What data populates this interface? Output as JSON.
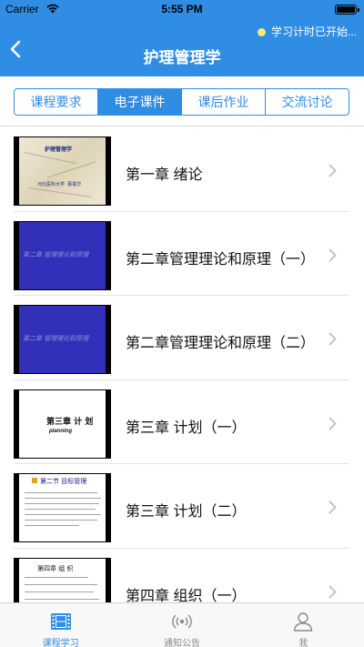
{
  "status_bar": {
    "carrier": "Carrier",
    "time": "5:55 PM"
  },
  "nav": {
    "title": "护理管理学",
    "timer_notice": "学习计时已开始..."
  },
  "tabs": [
    {
      "label": "课程要求",
      "active": false
    },
    {
      "label": "电子课件",
      "active": true
    },
    {
      "label": "课后作业",
      "active": false
    },
    {
      "label": "交流讨论",
      "active": false
    }
  ],
  "items": [
    {
      "title": "第一章 绪论",
      "thumb_lines": [
        "护理管理学",
        "河北医科大学",
        "蔡振华"
      ]
    },
    {
      "title": "第二章管理理论和原理（一）",
      "thumb_lines": [
        "第二章 管理理论和原理"
      ]
    },
    {
      "title": "第二章管理理论和原理（二）",
      "thumb_lines": [
        "第二章 管理理论和原理"
      ]
    },
    {
      "title": "第三章 计划（一）",
      "thumb_lines": [
        "第三章 计 划",
        "planning"
      ]
    },
    {
      "title": "第三章 计划（二）",
      "thumb_lines": [
        "第二节   目标管理"
      ]
    },
    {
      "title": "第四章 组织（一）",
      "thumb_lines": [
        "第四章  组  织"
      ]
    }
  ],
  "tab_bar": [
    {
      "label": "课程学习",
      "icon": "film-icon",
      "active": true
    },
    {
      "label": "通知公告",
      "icon": "broadcast-icon",
      "active": false
    },
    {
      "label": "我",
      "icon": "person-icon",
      "active": false
    }
  ],
  "colors": {
    "accent": "#2f8de4",
    "timer_dot": "#f7e97a",
    "slide_blue": "#3230b8"
  }
}
